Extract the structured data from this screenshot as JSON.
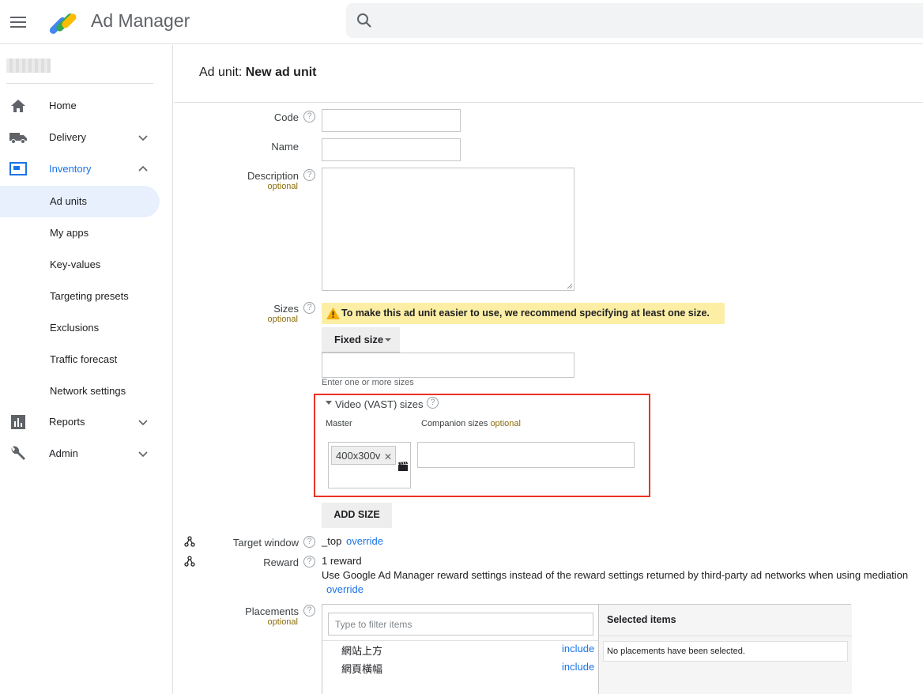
{
  "app": {
    "title": "Ad Manager"
  },
  "search": {
    "placeholder": ""
  },
  "sidebar": {
    "items": [
      {
        "label": "Home",
        "icon": "home-icon"
      },
      {
        "label": "Delivery",
        "icon": "truck-icon"
      },
      {
        "label": "Inventory",
        "icon": "inventory-icon",
        "active": true
      },
      {
        "label": "Reports",
        "icon": "bar-chart-icon"
      },
      {
        "label": "Admin",
        "icon": "wrench-icon"
      }
    ],
    "inventory_children": [
      {
        "label": "Ad units",
        "selected": true
      },
      {
        "label": "My apps"
      },
      {
        "label": "Key-values"
      },
      {
        "label": "Targeting presets"
      },
      {
        "label": "Exclusions"
      },
      {
        "label": "Traffic forecast"
      },
      {
        "label": "Network settings"
      }
    ]
  },
  "page": {
    "title_prefix": "Ad unit:",
    "title_name": "New ad unit"
  },
  "form": {
    "code_label": "Code",
    "name_label": "Name",
    "description_label": "Description",
    "optional_text": "optional",
    "sizes_label": "Sizes",
    "sizes_warning": "To make this ad unit easier to use, we recommend specifying at least one size.",
    "fixed_size_button": "Fixed size",
    "sizes_hint": "Enter one or more sizes",
    "vast": {
      "title": "Video (VAST) sizes",
      "master_label": "Master",
      "companion_label": "Companion sizes",
      "companion_optional": "optional",
      "master_chip": "400x300v"
    },
    "add_size_button": "ADD SIZE",
    "target_window_label": "Target window",
    "target_window_value": "_top",
    "override_text": "override",
    "reward_label": "Reward",
    "reward_value": "1 reward",
    "reward_note": "Use Google Ad Manager reward settings instead of the reward settings returned by third-party ad networks when using mediation",
    "placements_label": "Placements",
    "filter_placeholder": "Type to filter items",
    "placements": [
      {
        "name": "網站上方",
        "action": "include"
      },
      {
        "name": "網頁橫幅",
        "action": "include"
      }
    ],
    "selected_items_title": "Selected items",
    "selected_items_empty": "No placements have been selected."
  },
  "colors": {
    "accent": "#1a73e8",
    "warning_bg": "#fcefa5",
    "highlight_border": "#ea3323",
    "optional": "#8a6d0b"
  }
}
